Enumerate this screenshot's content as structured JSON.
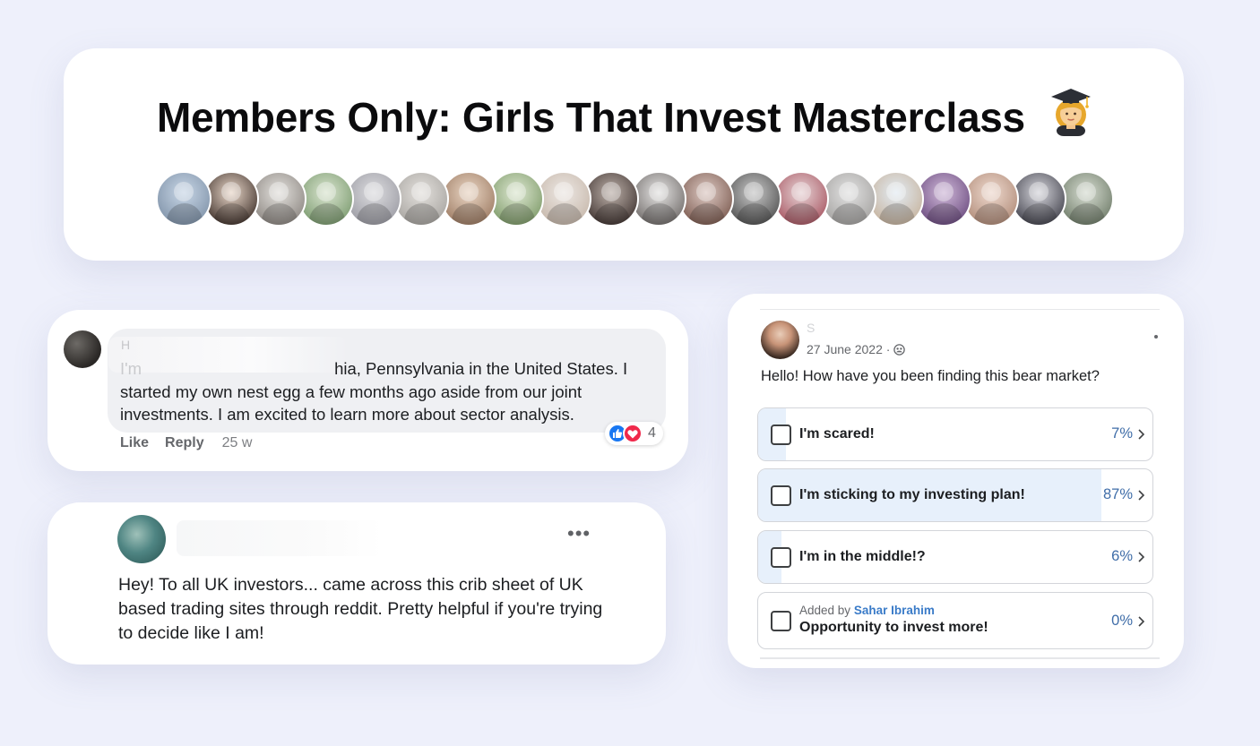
{
  "header": {
    "title": "Members Only: Girls That Invest Masterclass",
    "title_emoji": "woman-student-emoji",
    "member_avatars": [
      {
        "colors": [
          "#c8d6e6",
          "#7f92a8"
        ]
      },
      {
        "colors": [
          "#e8d6c8",
          "#3d2f29"
        ]
      },
      {
        "colors": [
          "#e2e0dc",
          "#8b8580"
        ]
      },
      {
        "colors": [
          "#d9e4cf",
          "#7a9a6e"
        ]
      },
      {
        "colors": [
          "#dcdcdf",
          "#9b9ba3"
        ]
      },
      {
        "colors": [
          "#e3e0dc",
          "#a7a4a0"
        ]
      },
      {
        "colors": [
          "#e9d5c3",
          "#9c7a62"
        ]
      },
      {
        "colors": [
          "#dde7d1",
          "#7d9a68"
        ]
      },
      {
        "colors": [
          "#ece7e3",
          "#c6b7aa"
        ]
      },
      {
        "colors": [
          "#bcb0a9",
          "#3f3330"
        ]
      },
      {
        "colors": [
          "#e4e3e2",
          "#6f6a68"
        ]
      },
      {
        "colors": [
          "#dcc8c2",
          "#7b5a4f"
        ]
      },
      {
        "colors": [
          "#c7c7c7",
          "#505050"
        ]
      },
      {
        "colors": [
          "#e6d2d4",
          "#a75561"
        ]
      },
      {
        "colors": [
          "#e1e1e1",
          "#a4a2a0"
        ]
      },
      {
        "colors": [
          "#e2ebf3",
          "#c6b29c"
        ]
      },
      {
        "colors": [
          "#cfb8d8",
          "#6a4a7e"
        ]
      },
      {
        "colors": [
          "#eed9ce",
          "#b08b78"
        ]
      },
      {
        "colors": [
          "#d4d4da",
          "#40404a"
        ]
      },
      {
        "colors": [
          "#d6dcd1",
          "#6e7b68"
        ]
      }
    ]
  },
  "comment": {
    "name_fragment": "H",
    "text_faded": "I'm",
    "text_main": "hia, Pennsylvania in the United States. I started my own nest egg a few months ago aside from our joint investments. I am excited to learn more about sector analysis.",
    "reaction_count": "4",
    "like_label": "Like",
    "reply_label": "Reply",
    "time": "25 w"
  },
  "post": {
    "more_label": "•••",
    "text": "Hey! To all UK investors... came across this crib sheet of UK based trading sites through reddit. Pretty helpful if you're trying to decide like I am!"
  },
  "poll": {
    "name_fragment": "S",
    "date": "27 June 2022 ·",
    "question": "Hello! How have you been finding this bear market?",
    "options": [
      {
        "label": "I'm scared!",
        "percent_label": "7%",
        "percent": 7
      },
      {
        "label": "I'm sticking to my investing plan!",
        "percent_label": "87%",
        "percent": 87
      },
      {
        "label": "I'm in the middle!?",
        "percent_label": "6%",
        "percent": 6
      },
      {
        "added_by_prefix": "Added by",
        "added_by_name": "Sahar Ibrahim",
        "label": "Opportunity to invest more!",
        "percent_label": "0%",
        "percent": 0
      }
    ],
    "accent_color": "#3f6da8",
    "fill_color": "#e7f0fb"
  }
}
